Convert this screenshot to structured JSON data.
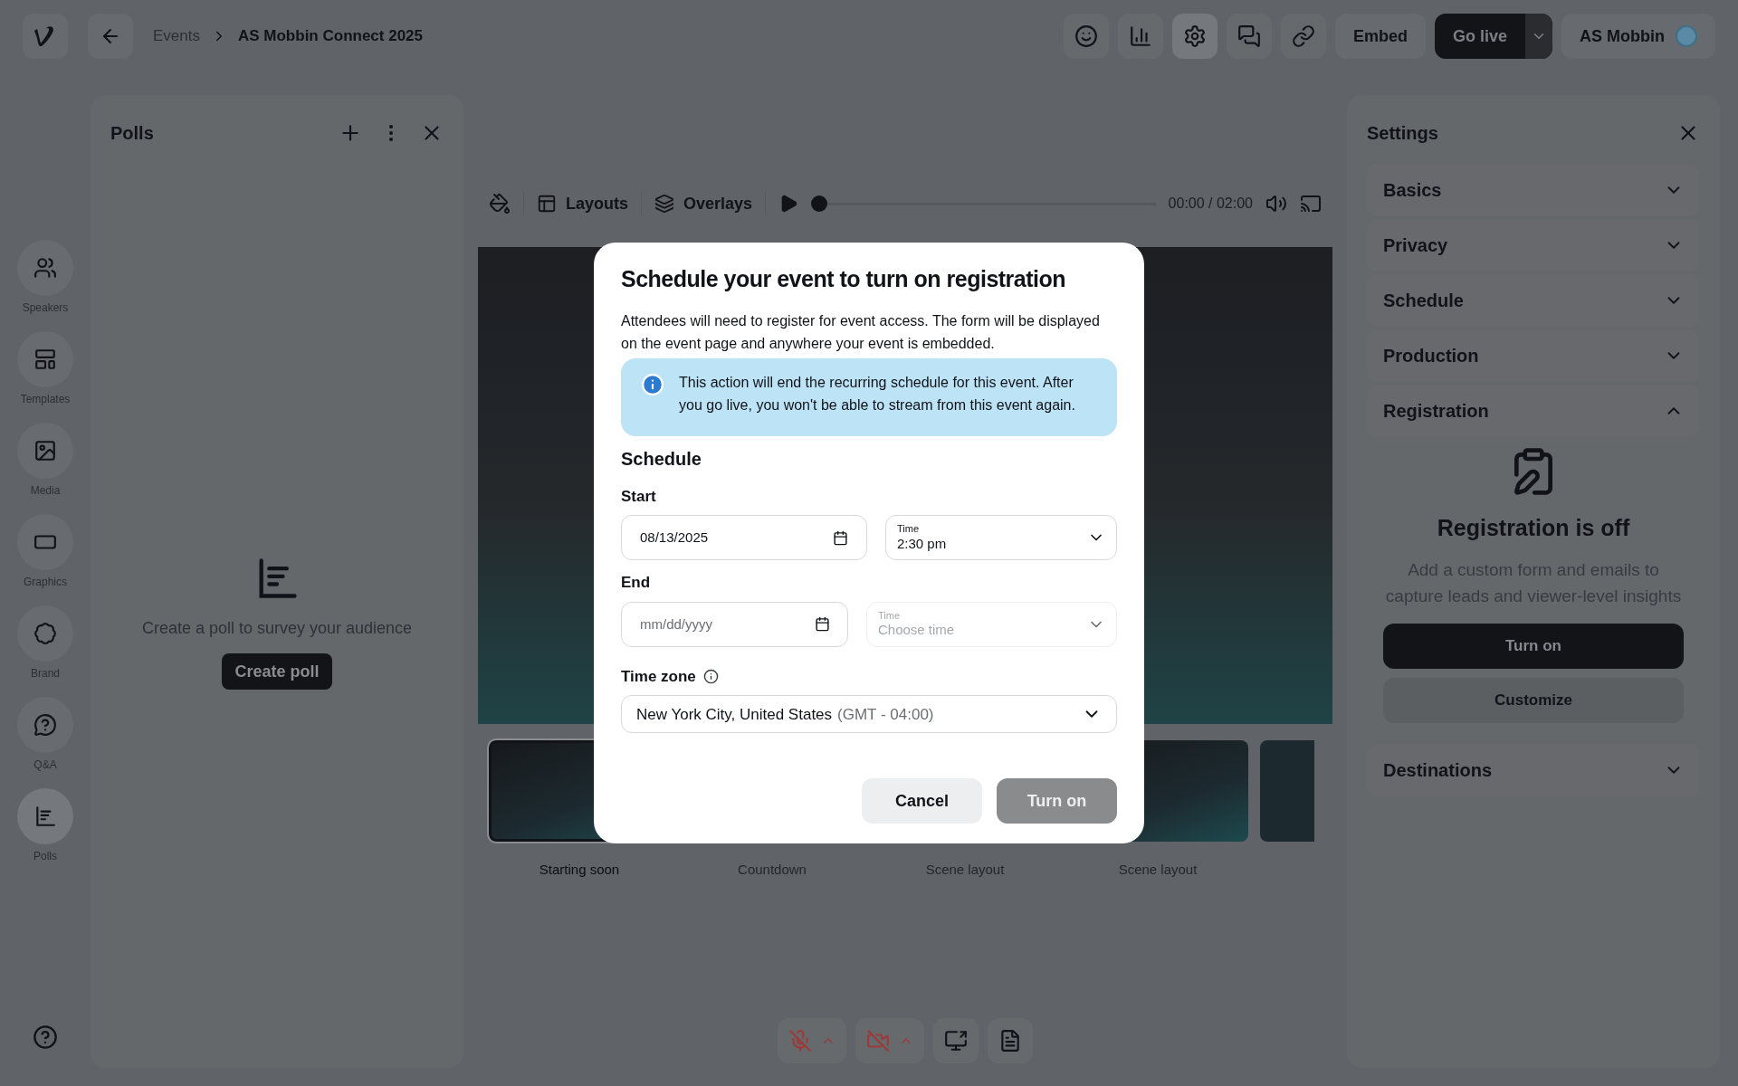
{
  "top_bar": {
    "breadcrumb": [
      "Events",
      "AS Mobbin Connect 2025"
    ],
    "icon_buttons": [
      {
        "kind": "status",
        "selected": false
      },
      {
        "kind": "chart",
        "selected": false
      },
      {
        "kind": "settings",
        "selected": true
      },
      {
        "kind": "chat",
        "selected": false
      },
      {
        "kind": "link",
        "selected": false
      }
    ],
    "embed": "Embed",
    "go_live": "Go live",
    "account": "AS Mobbin"
  },
  "rail": [
    {
      "kind": "speakers",
      "label": "Speakers",
      "selected": false
    },
    {
      "kind": "templates",
      "label": "Templates",
      "selected": false
    },
    {
      "kind": "media",
      "label": "Media",
      "selected": false
    },
    {
      "kind": "graphics",
      "label": "Graphics",
      "selected": false
    },
    {
      "kind": "brand",
      "label": "Brand",
      "selected": false
    },
    {
      "kind": "qa",
      "label": "Q&A",
      "selected": false
    },
    {
      "kind": "polls",
      "label": "Polls",
      "selected": true
    }
  ],
  "polls_panel": {
    "title": "Polls",
    "empty_text": "Create a poll to survey your audience",
    "button": "Create poll"
  },
  "stage_toolbar": {
    "tabs": [
      {
        "kind": "layouts",
        "label": "Layouts"
      },
      {
        "kind": "overlays",
        "label": "Overlays"
      }
    ],
    "level": 0,
    "time": "00:00 / 02:00"
  },
  "scenes": [
    {
      "label": "Starting soon",
      "selected": true
    },
    {
      "label": "Countdown",
      "selected": false
    },
    {
      "label": "Scene layout",
      "selected": false
    },
    {
      "label": "Scene layout",
      "selected": false
    }
  ],
  "media_controls": [
    {
      "kind": "mic",
      "off": true
    },
    {
      "kind": "camera",
      "off": true
    },
    {
      "kind": "share",
      "off": false
    },
    {
      "kind": "notes",
      "off": false
    }
  ],
  "settings": {
    "title": "Settings",
    "sections": [
      {
        "title": "Basics",
        "expanded": false
      },
      {
        "title": "Privacy",
        "expanded": false
      },
      {
        "title": "Schedule",
        "expanded": false
      },
      {
        "title": "Production",
        "expanded": false
      },
      {
        "title": "Registration",
        "expanded": true
      },
      {
        "title": "Destinations",
        "expanded": false
      }
    ],
    "registration": {
      "heading": "Registration is off",
      "text": "Add a custom form and emails to capture leads and viewer-level insights",
      "primary": "Turn on",
      "secondary": "Customize"
    }
  },
  "modal": {
    "title": "Schedule your event to turn on registration",
    "description": "Attendees will need to register for event access. The form will be displayed on the event page and anywhere your event is embedded.",
    "notice": "This action will end the recurring schedule for this event. After you go live, you won't be able to stream from this event again.",
    "section": "Schedule",
    "start": {
      "label": "Start",
      "date": "08/13/2025",
      "time_label": "Time",
      "time": "2:30 pm"
    },
    "end": {
      "label": "End",
      "date_placeholder": "mm/dd/yyyy",
      "time_label": "Time",
      "time_placeholder": "Choose time"
    },
    "time_zone": {
      "label": "Time zone",
      "value": "New York City, United States",
      "offset": "(GMT - 04:00)"
    },
    "cancel": "Cancel",
    "confirm": {
      "label": "Turn on",
      "disabled": true
    }
  }
}
